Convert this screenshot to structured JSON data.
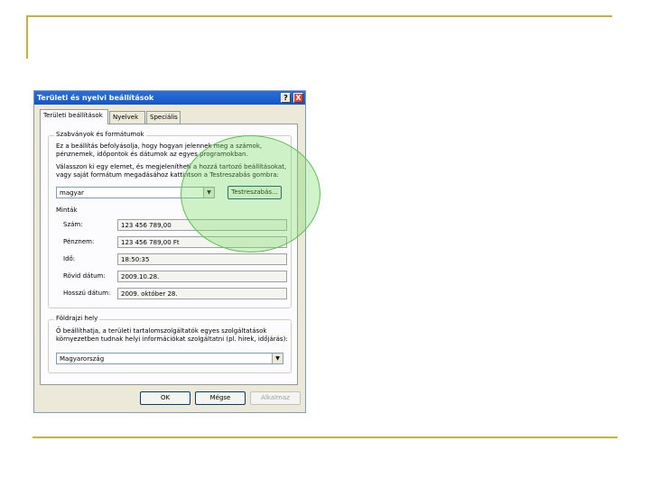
{
  "dialog": {
    "title": "Területi és nyelvi beállítások",
    "help_btn": "?",
    "close_btn": "X",
    "tabs": [
      "Területi beállítások",
      "Nyelvek",
      "Speciális"
    ],
    "formats_group": {
      "legend": "Szabványok és formátumok",
      "description_line1": "Ez a beállítás befolyásolja, hogy hogyan jelennek meg a számok,",
      "description_line2": "pénznemek, időpontok és dátumok az egyes programokban.",
      "instruction_line1": "Válasszon ki egy elemet, és megjelenítheti a hozzá tartozó beállításokat,",
      "instruction_line2": "vagy saját formátum megadásához kattintson a Testreszabás gombra:",
      "locale_value": "magyar",
      "customize_label": "Testreszabás...",
      "samples_label": "Minták",
      "rows": [
        {
          "label": "Szám:",
          "value": "123 456 789,00"
        },
        {
          "label": "Pénznem:",
          "value": "123 456 789,00 Ft"
        },
        {
          "label": "Idő:",
          "value": "18:50:35"
        },
        {
          "label": "Rövid dátum:",
          "value": "2009.10.28."
        },
        {
          "label": "Hosszú dátum:",
          "value": "2009. október 28."
        }
      ]
    },
    "location_group": {
      "legend": "Földrajzi hely",
      "description_line1": "Ő beállíthatja, a területi tartalomszolgáltatók egyes szolgáltatások",
      "description_line2": "környezetben tudnak helyi információkat szolgáltatni (pl. hírek, időjárás):",
      "location_value": "Magyarország"
    },
    "buttons": {
      "ok": "OK",
      "cancel": "Mégse",
      "apply": "Alkalmaz"
    }
  },
  "colors": {
    "accent_line": "#c8b43c",
    "highlight": "#78dc64"
  }
}
